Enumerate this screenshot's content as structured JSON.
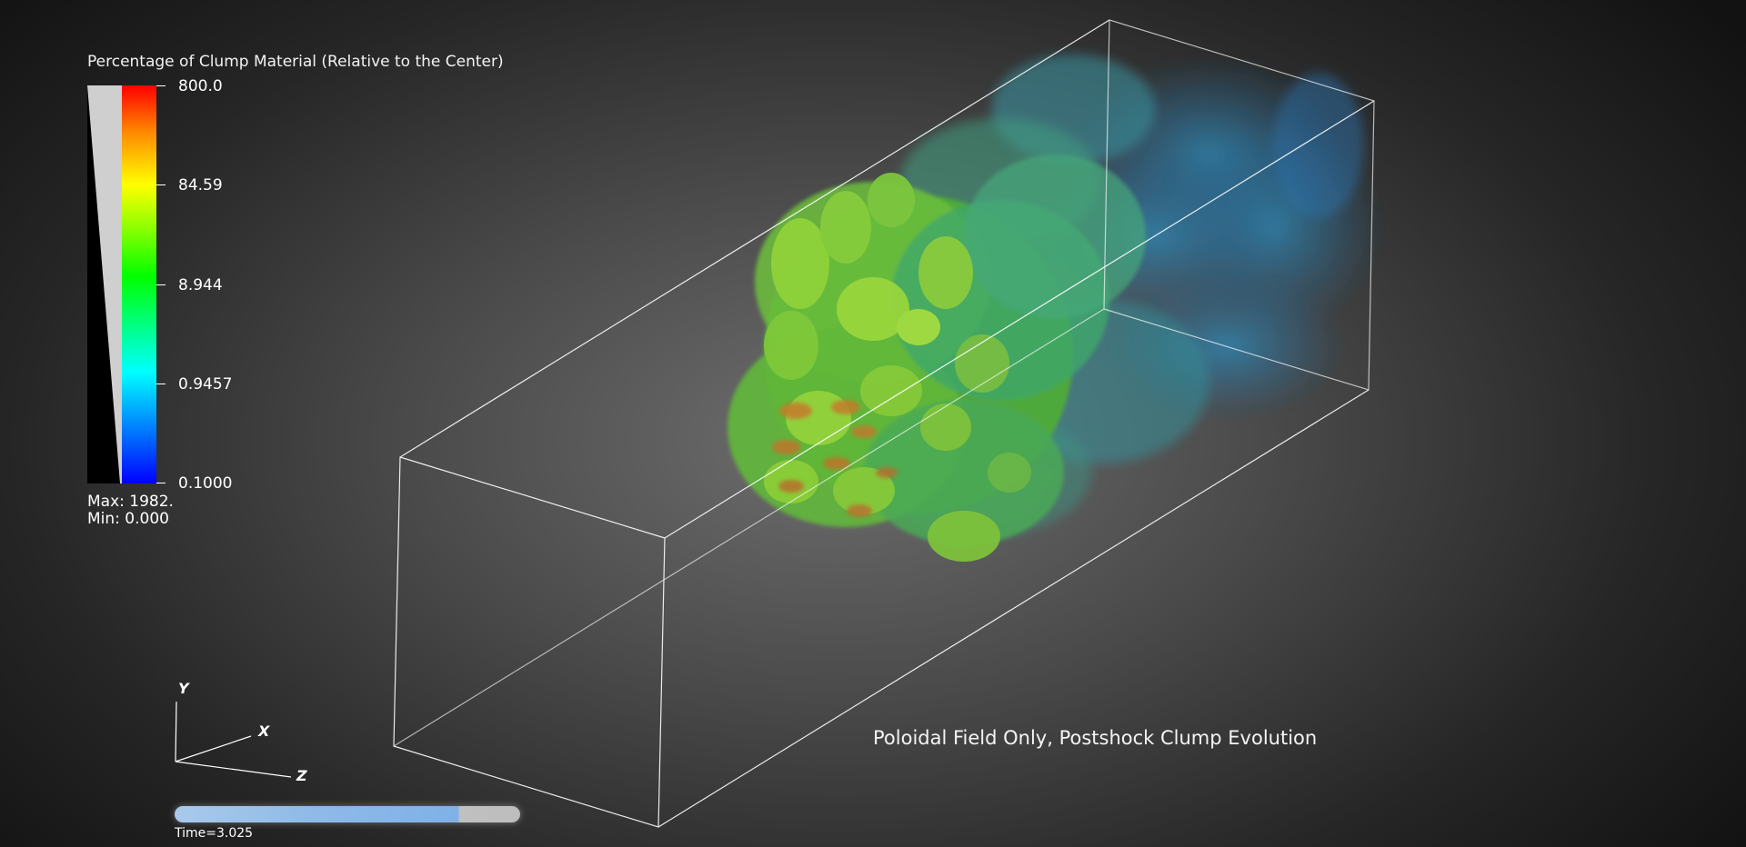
{
  "legend": {
    "title": "Percentage of Clump Material (Relative to the Center)",
    "ticks": [
      "800.0",
      "84.59",
      "8.944",
      "0.9457",
      "0.1000"
    ],
    "max_text": "Max:  1982.",
    "min_text": "Min:  0.000",
    "colormap": [
      "#0000ff",
      "#00ffff",
      "#00ff00",
      "#ffff00",
      "#ff0000"
    ]
  },
  "axes": {
    "y": "Y",
    "x": "X",
    "z": "Z"
  },
  "caption": "Poloidal Field Only, Postshock Clump Evolution",
  "time": {
    "label": "Time=3.025",
    "progress": 0.82
  },
  "colors": {
    "bounding_box": "#ffffff",
    "background_center": "#6e6e6e",
    "background_edge": "#121212"
  }
}
